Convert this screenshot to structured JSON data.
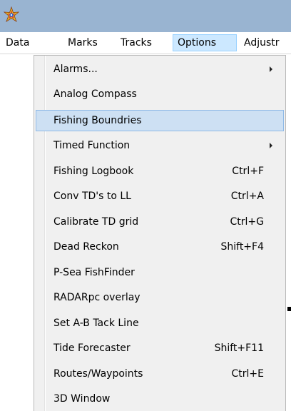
{
  "app": {
    "icon": "star-compass-app-icon"
  },
  "menubar": {
    "items": [
      {
        "label": "Data"
      },
      {
        "label": "Marks"
      },
      {
        "label": "Tracks"
      },
      {
        "label": "Options"
      },
      {
        "label": "Adjustr"
      }
    ],
    "active": "Options"
  },
  "options_menu": {
    "items": [
      {
        "label": "Alarms...",
        "shortcut": "",
        "submenu": true
      },
      {
        "label": "Analog Compass",
        "shortcut": "",
        "submenu": false
      },
      {
        "label": "Fishing Boundries",
        "shortcut": "",
        "submenu": false,
        "highlighted": true
      },
      {
        "label": "Timed Function",
        "shortcut": "",
        "submenu": true
      },
      {
        "label": "Fishing Logbook",
        "shortcut": "Ctrl+F",
        "submenu": false
      },
      {
        "label": "Conv TD's to LL",
        "shortcut": "Ctrl+A",
        "submenu": false
      },
      {
        "label": "Calibrate TD grid",
        "shortcut": "Ctrl+G",
        "submenu": false
      },
      {
        "label": "Dead Reckon",
        "shortcut": "Shift+F4",
        "submenu": false
      },
      {
        "label": "P-Sea FishFinder",
        "shortcut": "",
        "submenu": false
      },
      {
        "label": "RADARpc overlay",
        "shortcut": "",
        "submenu": false
      },
      {
        "label": "Set A-B Tack Line",
        "shortcut": "",
        "submenu": false
      },
      {
        "label": "Tide Forecaster",
        "shortcut": "Shift+F11",
        "submenu": false
      },
      {
        "label": "Routes/Waypoints",
        "shortcut": "Ctrl+E",
        "submenu": false
      },
      {
        "label": "3D Window",
        "shortcut": "",
        "submenu": false
      }
    ]
  },
  "colors": {
    "titlebar": "#99b4d1",
    "menubar_active_bg": "#cce8ff",
    "menu_bg": "#f0f0f0",
    "menu_highlight_bg": "#cde0f3",
    "menu_highlight_border": "#8fb9e6"
  }
}
